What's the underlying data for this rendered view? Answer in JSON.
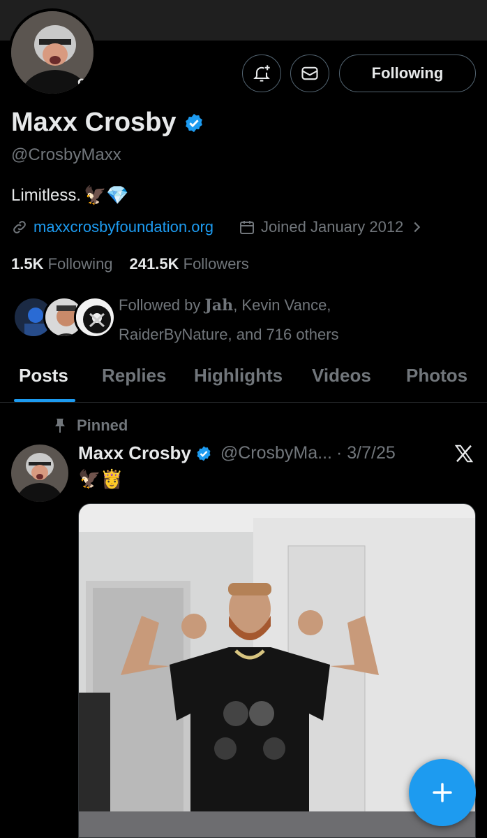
{
  "profile": {
    "name": "Maxx Crosby",
    "handle": "@CrosbyMaxx",
    "bio_text": "Limitless.",
    "bio_emojis": "🦅💎",
    "website": "maxxcrosbyfoundation.org",
    "joined": "Joined January 2012",
    "following_count": "1.5K",
    "following_label": "Following",
    "followers_count": "241.5K",
    "followers_label": "Followers",
    "followed_by_prefix": "Followed by ",
    "followed_by_bold": "Jah",
    "followed_by_rest": ", Kevin Vance,",
    "followed_by_line2": "RaiderByNature, and 716 others",
    "verified": true
  },
  "header_buttons": {
    "follow_label": "Following",
    "bell_icon": "bell-plus-icon",
    "message_icon": "envelope-icon"
  },
  "tabs": [
    {
      "label": "Posts",
      "active": true
    },
    {
      "label": "Replies",
      "active": false
    },
    {
      "label": "Highlights",
      "active": false
    },
    {
      "label": "Videos",
      "active": false
    },
    {
      "label": "Photos",
      "active": false
    }
  ],
  "post": {
    "pinned_label": "Pinned",
    "author_name": "Maxx Crosby",
    "author_handle": "@CrosbyMa...",
    "date": "· 3/7/25",
    "text": "🦅👸"
  },
  "colors": {
    "accent": "#1d9bf0",
    "background": "#000000",
    "muted_text": "#71767b",
    "primary_text": "#e7e9ea"
  }
}
